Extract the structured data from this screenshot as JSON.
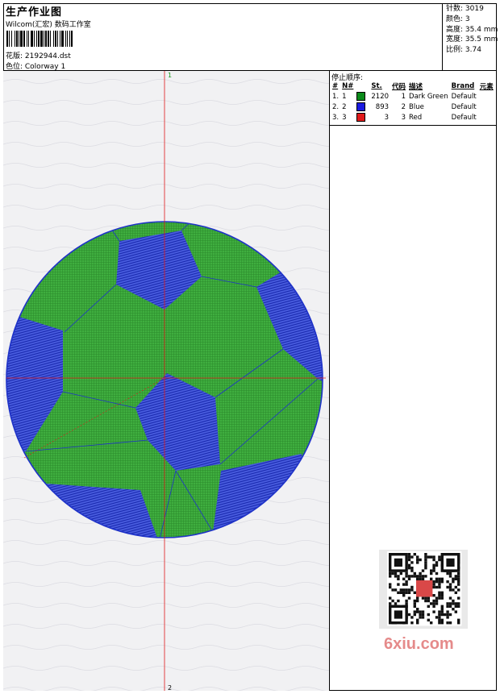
{
  "header": {
    "title": "生产作业图",
    "company": "Wilcom(汇宏) 数码工作室",
    "design_label": "花版: 2192944.dst",
    "colorway_label": "色位: Colorway 1"
  },
  "stats": [
    {
      "label": "针数:",
      "value": "3019"
    },
    {
      "label": "颜色:",
      "value": "3"
    },
    {
      "label": "高度:",
      "value": "35.4 mm"
    },
    {
      "label": "宽度:",
      "value": "35.5 mm"
    },
    {
      "label": "比例:",
      "value": "3.74"
    }
  ],
  "stop_sequence": {
    "title": "停止顺序:",
    "columns": [
      "#",
      "N#",
      "St.",
      "代码",
      "描述",
      "Brand",
      "元素"
    ],
    "rows": [
      {
        "idx": "1.",
        "n": "1",
        "color": "#0a8a1a",
        "st": "2120",
        "code": "1",
        "desc": "Dark Green",
        "brand": "Default"
      },
      {
        "idx": "2.",
        "n": "2",
        "color": "#1a1ae0",
        "st": "893",
        "code": "2",
        "desc": "Blue",
        "brand": "Default"
      },
      {
        "idx": "3.",
        "n": "3",
        "color": "#e01a1a",
        "st": "3",
        "code": "3",
        "desc": "Red",
        "brand": "Default"
      }
    ]
  },
  "canvas": {
    "axis_top_label": "1",
    "axis_bottom_label": "2",
    "stitch_colors": {
      "fill": "#3aa33a",
      "outline": "#1e32c8",
      "axis": "#e01a1a"
    }
  },
  "watermark": {
    "site": "6xiu.com"
  }
}
